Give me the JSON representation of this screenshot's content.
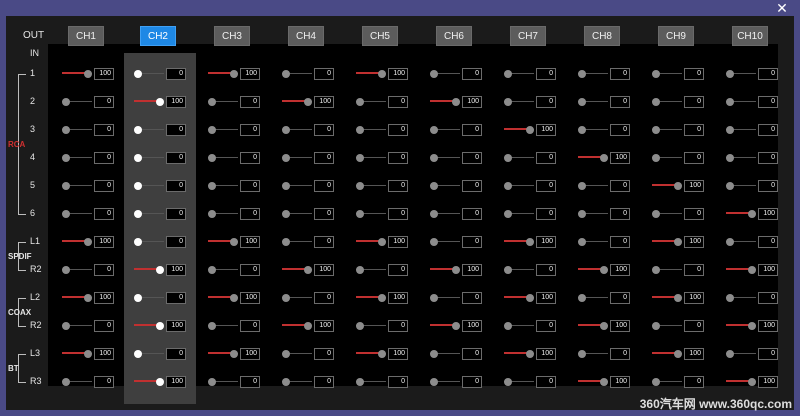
{
  "window": {
    "close_label": "✕"
  },
  "labels": {
    "out": "OUT",
    "in": "IN"
  },
  "channels": [
    "CH1",
    "CH2",
    "CH3",
    "CH4",
    "CH5",
    "CH6",
    "CH7",
    "CH8",
    "CH9",
    "CH10"
  ],
  "active_channel_index": 1,
  "rows": [
    "1",
    "2",
    "3",
    "4",
    "5",
    "6",
    "L1",
    "R2",
    "L2",
    "R2",
    "L3",
    "R3"
  ],
  "groups": [
    {
      "name": "SPDIF"
    },
    {
      "name": "COAX"
    },
    {
      "name": "BT"
    },
    {
      "name": "RCA",
      "color": "#d03030"
    }
  ],
  "matrix": [
    [
      100,
      0,
      100,
      0,
      100,
      0,
      0,
      0,
      0,
      0
    ],
    [
      0,
      100,
      0,
      100,
      0,
      100,
      0,
      0,
      0,
      0
    ],
    [
      0,
      0,
      0,
      0,
      0,
      0,
      100,
      0,
      0,
      0
    ],
    [
      0,
      0,
      0,
      0,
      0,
      0,
      0,
      100,
      0,
      0
    ],
    [
      0,
      0,
      0,
      0,
      0,
      0,
      0,
      0,
      100,
      0
    ],
    [
      0,
      0,
      0,
      0,
      0,
      0,
      0,
      0,
      0,
      100
    ],
    [
      100,
      0,
      100,
      0,
      100,
      0,
      100,
      0,
      100,
      0
    ],
    [
      0,
      100,
      0,
      100,
      0,
      100,
      0,
      100,
      0,
      100
    ],
    [
      100,
      0,
      100,
      0,
      100,
      0,
      100,
      0,
      100,
      0
    ],
    [
      0,
      100,
      0,
      100,
      0,
      100,
      0,
      100,
      0,
      100
    ],
    [
      100,
      0,
      100,
      0,
      100,
      0,
      100,
      0,
      100,
      0
    ],
    [
      0,
      100,
      0,
      0,
      0,
      0,
      0,
      100,
      0,
      100
    ]
  ],
  "watermark": "360汽车网 www.360qc.com",
  "colors": {
    "active": "#1e88e5",
    "fill": "#c03030",
    "background": "#4a4a86"
  }
}
